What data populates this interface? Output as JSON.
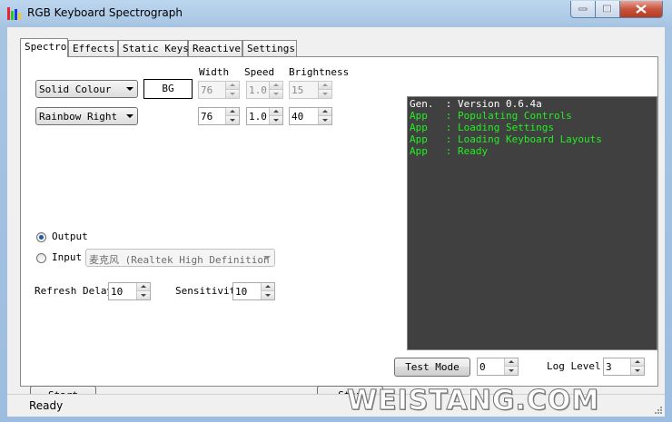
{
  "window": {
    "title": "RGB Keyboard Spectrograph"
  },
  "tabs": [
    {
      "label": "Spectro",
      "active": true
    },
    {
      "label": "Effects",
      "active": false
    },
    {
      "label": "Static Keys",
      "active": false
    },
    {
      "label": "Reactive",
      "active": false
    },
    {
      "label": "Settings",
      "active": false
    }
  ],
  "spectro": {
    "headers": {
      "width": "Width",
      "speed": "Speed",
      "brightness": "Brightness"
    },
    "row1": {
      "effect": "Solid Colour",
      "bg_label": "BG",
      "width": "76",
      "speed": "1.0",
      "brightness": "15"
    },
    "row2": {
      "effect": "Rainbow Right",
      "width": "76",
      "speed": "1.0",
      "brightness": "40"
    },
    "source": {
      "output_label": "Output",
      "input_label": "Input",
      "selected": "Output",
      "input_device": "麦克风 (Realtek High Definition"
    },
    "refresh_delay": {
      "label": "Refresh Delay",
      "value": "10"
    },
    "sensitivity": {
      "label": "Sensitivit",
      "value": "10"
    },
    "start_label": "Start",
    "stop_label": "Stop"
  },
  "log": {
    "lines": [
      {
        "text": "Gen.  : Version 0.6.4a",
        "color": "#ffffff"
      },
      {
        "text": "App   : Populating Controls",
        "color": "#22ee22"
      },
      {
        "text": "App   : Loading Settings",
        "color": "#22ee22"
      },
      {
        "text": "App   : Loading Keyboard Layouts",
        "color": "#22ee22"
      },
      {
        "text": "App   : Ready",
        "color": "#22ee22"
      }
    ]
  },
  "bottom": {
    "test_mode_label": "Test Mode",
    "test_mode_value": "0",
    "log_level_label": "Log Level:",
    "log_level_value": "3"
  },
  "status": {
    "text": "Ready"
  },
  "watermark": "WEISTANG.COM"
}
